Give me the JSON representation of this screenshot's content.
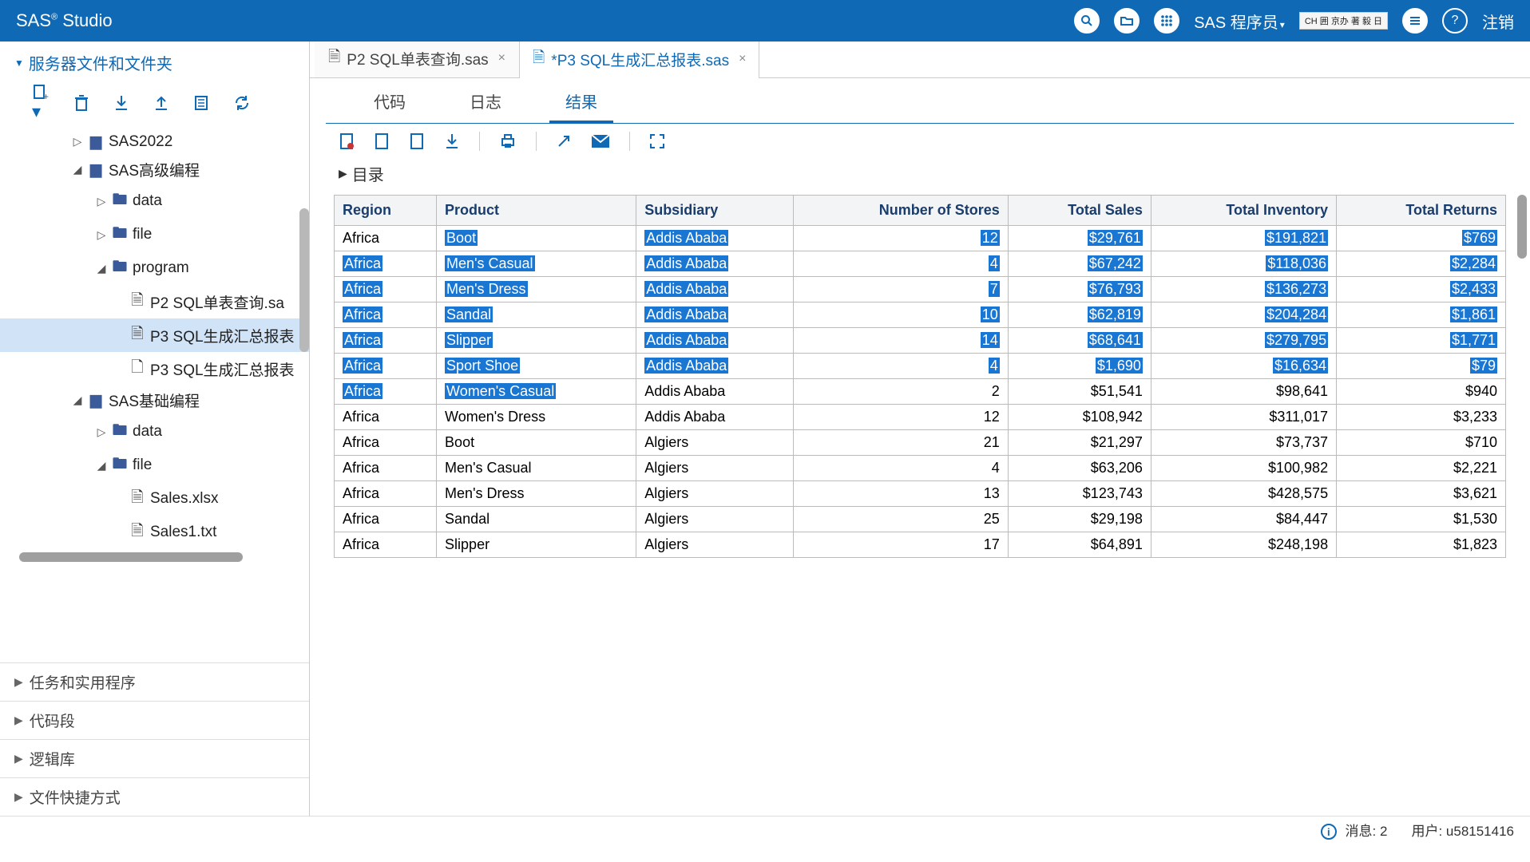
{
  "header": {
    "app_name_pre": "SAS",
    "app_name_post": " Studio",
    "programmer_label": "SAS 程序员",
    "signout": "注销",
    "ime_text": "CH 囲 京办 著 毅 日"
  },
  "sidebar": {
    "panel_title": "服务器文件和文件夹",
    "tree": {
      "sas2022": "SAS2022",
      "adv": "SAS高级编程",
      "data": "data",
      "file": "file",
      "program": "program",
      "p2": "P2 SQL单表查询.sa",
      "p3a": "P3 SQL生成汇总报表",
      "p3b": "P3 SQL生成汇总报表",
      "basic": "SAS基础编程",
      "data2": "data",
      "file2": "file",
      "salesx": "Sales.xlsx",
      "salest": "Sales1.txt"
    },
    "sections": {
      "tasks": "任务和实用程序",
      "snippets": "代码段",
      "libraries": "逻辑库",
      "shortcuts": "文件快捷方式"
    }
  },
  "tabs": {
    "t1": "P2 SQL单表查询.sas",
    "t2": "*P3 SQL生成汇总报表.sas"
  },
  "subtabs": {
    "code": "代码",
    "log": "日志",
    "results": "结果"
  },
  "toc": "目录",
  "table": {
    "headers": {
      "region": "Region",
      "product": "Product",
      "subsidiary": "Subsidiary",
      "stores": "Number of Stores",
      "sales": "Total Sales",
      "inventory": "Total Inventory",
      "returns": "Total Returns"
    },
    "rows": [
      {
        "region": "Africa",
        "product": "Boot",
        "subsidiary": "Addis Ababa",
        "stores": "12",
        "sales": "$29,761",
        "inventory": "$191,821",
        "returns": "$769",
        "hl": [
          "product",
          "subsidiary",
          "stores",
          "sales",
          "inventory",
          "returns"
        ]
      },
      {
        "region": "Africa",
        "product": "Men's Casual",
        "subsidiary": "Addis Ababa",
        "stores": "4",
        "sales": "$67,242",
        "inventory": "$118,036",
        "returns": "$2,284",
        "hl": [
          "region",
          "product",
          "subsidiary",
          "stores",
          "sales",
          "inventory",
          "returns"
        ]
      },
      {
        "region": "Africa",
        "product": "Men's Dress",
        "subsidiary": "Addis Ababa",
        "stores": "7",
        "sales": "$76,793",
        "inventory": "$136,273",
        "returns": "$2,433",
        "hl": [
          "region",
          "product",
          "subsidiary",
          "stores",
          "sales",
          "inventory",
          "returns"
        ]
      },
      {
        "region": "Africa",
        "product": "Sandal",
        "subsidiary": "Addis Ababa",
        "stores": "10",
        "sales": "$62,819",
        "inventory": "$204,284",
        "returns": "$1,861",
        "hl": [
          "region",
          "product",
          "subsidiary",
          "stores",
          "sales",
          "inventory",
          "returns"
        ]
      },
      {
        "region": "Africa",
        "product": "Slipper",
        "subsidiary": "Addis Ababa",
        "stores": "14",
        "sales": "$68,641",
        "inventory": "$279,795",
        "returns": "$1,771",
        "hl": [
          "region",
          "product",
          "subsidiary",
          "stores",
          "sales",
          "inventory",
          "returns"
        ]
      },
      {
        "region": "Africa",
        "product": "Sport Shoe",
        "subsidiary": "Addis Ababa",
        "stores": "4",
        "sales": "$1,690",
        "inventory": "$16,634",
        "returns": "$79",
        "hl": [
          "region",
          "product",
          "subsidiary",
          "stores",
          "sales",
          "inventory",
          "returns"
        ]
      },
      {
        "region": "Africa",
        "product": "Women's Casual",
        "subsidiary": "Addis Ababa",
        "stores": "2",
        "sales": "$51,541",
        "inventory": "$98,641",
        "returns": "$940",
        "hl": [
          "region",
          "product"
        ]
      },
      {
        "region": "Africa",
        "product": "Women's Dress",
        "subsidiary": "Addis Ababa",
        "stores": "12",
        "sales": "$108,942",
        "inventory": "$311,017",
        "returns": "$3,233",
        "hl": []
      },
      {
        "region": "Africa",
        "product": "Boot",
        "subsidiary": "Algiers",
        "stores": "21",
        "sales": "$21,297",
        "inventory": "$73,737",
        "returns": "$710",
        "hl": []
      },
      {
        "region": "Africa",
        "product": "Men's Casual",
        "subsidiary": "Algiers",
        "stores": "4",
        "sales": "$63,206",
        "inventory": "$100,982",
        "returns": "$2,221",
        "hl": []
      },
      {
        "region": "Africa",
        "product": "Men's Dress",
        "subsidiary": "Algiers",
        "stores": "13",
        "sales": "$123,743",
        "inventory": "$428,575",
        "returns": "$3,621",
        "hl": []
      },
      {
        "region": "Africa",
        "product": "Sandal",
        "subsidiary": "Algiers",
        "stores": "25",
        "sales": "$29,198",
        "inventory": "$84,447",
        "returns": "$1,530",
        "hl": []
      },
      {
        "region": "Africa",
        "product": "Slipper",
        "subsidiary": "Algiers",
        "stores": "17",
        "sales": "$64,891",
        "inventory": "$248,198",
        "returns": "$1,823",
        "hl": []
      }
    ]
  },
  "status": {
    "messages_label": "消息: ",
    "messages_count": "2",
    "user_label": "用户: ",
    "user_value": "u58151416"
  }
}
